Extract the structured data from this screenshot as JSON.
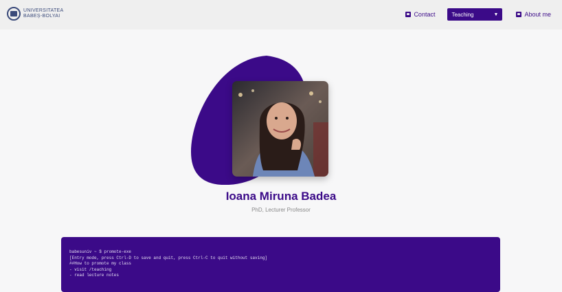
{
  "header": {
    "logo_text_line1": "UNIVERSITATEA",
    "logo_text_line2": "BABEȘ-BOLYAI",
    "nav": {
      "contact_label": "Contact",
      "select_value": "Teaching",
      "about_label": "About me"
    }
  },
  "profile": {
    "name": "Ioana Miruna Badea",
    "title": "PhD, Lecturer Professor"
  },
  "terminal": {
    "lines": [
      "babesuniv ~ $ promote-exe",
      "[Entry mode, press Ctrl-D to save and quit, press Ctrl-C to quit without saving]",
      "",
      "##How to promote my class",
      "",
      "- visit /teaching",
      "- read lecture notes"
    ]
  },
  "colors": {
    "accent": "#3b0a88",
    "background": "#f7f7f8",
    "header_bg": "#efefef"
  },
  "icons": {
    "contact": "contact-card-icon",
    "about": "person-badge-icon",
    "select": "chevron-down-icon",
    "logo": "university-seal-icon"
  }
}
